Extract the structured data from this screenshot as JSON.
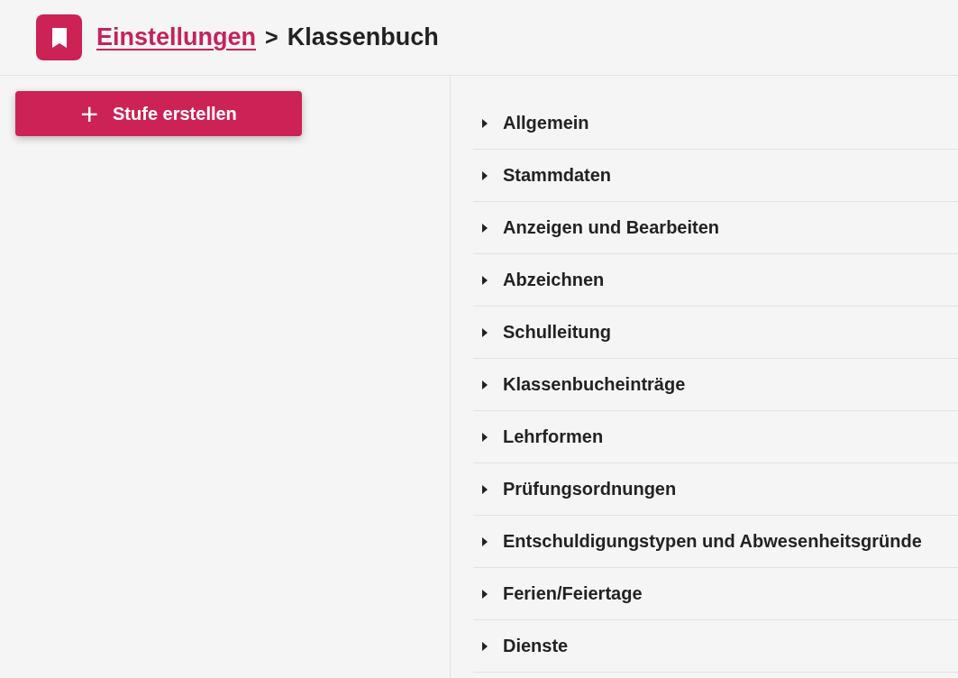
{
  "breadcrumb": {
    "parent": "Einstellungen",
    "separator": ">",
    "current": "Klassenbuch"
  },
  "create_button": {
    "icon": "+",
    "label": "Stufe erstellen"
  },
  "sections": [
    {
      "label": "Allgemein",
      "expanded": false
    },
    {
      "label": "Stammdaten",
      "expanded": false
    },
    {
      "label": "Anzeigen und Bearbeiten",
      "expanded": false
    },
    {
      "label": "Abzeichnen",
      "expanded": false
    },
    {
      "label": "Schulleitung",
      "expanded": false
    },
    {
      "label": "Klassenbucheinträge",
      "expanded": false
    },
    {
      "label": "Lehrformen",
      "expanded": false
    },
    {
      "label": "Prüfungsordnungen",
      "expanded": false
    },
    {
      "label": "Entschuldigungstypen und Abwesenheitsgründe",
      "expanded": false
    },
    {
      "label": "Ferien/Feiertage",
      "expanded": false
    },
    {
      "label": "Dienste",
      "expanded": false
    }
  ]
}
